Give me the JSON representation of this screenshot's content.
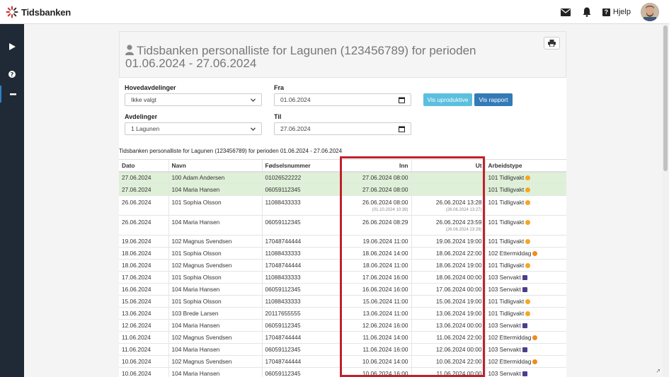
{
  "app": {
    "brand": "Tidsbanken",
    "help_label": "Hjelp"
  },
  "report": {
    "title": "Tidsbanken personalliste for Lagunen (123456789) for perioden 01.06.2024 - 27.06.2024",
    "caption": "Tidsbanken personalliste for Lagunen (123456789) for perioden 01.06.2024 - 27.06.2024"
  },
  "filters": {
    "hovedavdelinger_label": "Hovedavdelinger",
    "hovedavdelinger_value": "Ikke valgt",
    "avdelinger_label": "Avdelinger",
    "avdelinger_value": "1 Lagunen",
    "fra_label": "Fra",
    "fra_value": "01.06.2024",
    "til_label": "Til",
    "til_value": "27.06.2024",
    "btn_uproduktive": "Vis uproduktive",
    "btn_rapport": "Vis rapport"
  },
  "table": {
    "headers": {
      "dato": "Dato",
      "navn": "Navn",
      "fnr": "Fødselsnummer",
      "inn": "Inn",
      "ut": "Ut",
      "type": "Arbeidstype"
    },
    "rows": [
      {
        "dato": "27.06.2024",
        "navn": "100 Adam Andersen",
        "fnr": "01026522222",
        "inn": "27.06.2024 08:00",
        "inn_sub": "",
        "ut": "",
        "ut_sub": "",
        "type": "101 Tidligvakt",
        "icon": "sun-icon",
        "hl": true
      },
      {
        "dato": "27.06.2024",
        "navn": "104 Maria Hansen",
        "fnr": "06059112345",
        "inn": "27.06.2024 08:00",
        "inn_sub": "",
        "ut": "",
        "ut_sub": "",
        "type": "101 Tidligvakt",
        "icon": "sun-icon",
        "hl": true
      },
      {
        "dato": "26.06.2024",
        "navn": "101 Sophia Olsson",
        "fnr": "11088433333",
        "inn": "26.06.2024 08:00",
        "inn_sub": "(01.10.2024 10:39)",
        "ut": "26.06.2024 13:28",
        "ut_sub": "(26.06.2024 13:27)",
        "type": "101 Tidligvakt",
        "icon": "sun-icon",
        "hl": false
      },
      {
        "dato": "26.06.2024",
        "navn": "104 Maria Hansen",
        "fnr": "06059112345",
        "inn": "26.06.2024 08:29",
        "inn_sub": "",
        "ut": "26.06.2024 23:59",
        "ut_sub": "(26.06.2024 23:29)",
        "type": "101 Tidligvakt",
        "icon": "sun-icon",
        "hl": false
      },
      {
        "dato": "19.06.2024",
        "navn": "102 Magnus Svendsen",
        "fnr": "17048744444",
        "inn": "19.06.2024 11:00",
        "inn_sub": "",
        "ut": "19.06.2024 19:00",
        "ut_sub": "",
        "type": "101 Tidligvakt",
        "icon": "sun-icon",
        "hl": false
      },
      {
        "dato": "18.06.2024",
        "navn": "101 Sophia Olsson",
        "fnr": "11088433333",
        "inn": "18.06.2024 14:00",
        "inn_sub": "",
        "ut": "18.06.2024 22:00",
        "ut_sub": "",
        "type": "102 Ettermiddag",
        "icon": "sunset-icon",
        "hl": false
      },
      {
        "dato": "18.06.2024",
        "navn": "102 Magnus Svendsen",
        "fnr": "17048744444",
        "inn": "18.06.2024 11:00",
        "inn_sub": "",
        "ut": "18.06.2024 19:00",
        "ut_sub": "",
        "type": "101 Tidligvakt",
        "icon": "sun-icon",
        "hl": false
      },
      {
        "dato": "17.06.2024",
        "navn": "101 Sophia Olsson",
        "fnr": "11088433333",
        "inn": "17.06.2024 16:00",
        "inn_sub": "",
        "ut": "18.06.2024 00:00",
        "ut_sub": "",
        "type": "103 Senvakt",
        "icon": "moon-icon",
        "hl": false
      },
      {
        "dato": "16.06.2024",
        "navn": "104 Maria Hansen",
        "fnr": "06059112345",
        "inn": "16.06.2024 16:00",
        "inn_sub": "",
        "ut": "17.06.2024 00:00",
        "ut_sub": "",
        "type": "103 Senvakt",
        "icon": "moon-icon",
        "hl": false
      },
      {
        "dato": "15.06.2024",
        "navn": "101 Sophia Olsson",
        "fnr": "11088433333",
        "inn": "15.06.2024 11:00",
        "inn_sub": "",
        "ut": "15.06.2024 19:00",
        "ut_sub": "",
        "type": "101 Tidligvakt",
        "icon": "sun-icon",
        "hl": false
      },
      {
        "dato": "13.06.2024",
        "navn": "103 Brede Larsen",
        "fnr": "20117655555",
        "inn": "13.06.2024 11:00",
        "inn_sub": "",
        "ut": "13.06.2024 19:00",
        "ut_sub": "",
        "type": "101 Tidligvakt",
        "icon": "sun-icon",
        "hl": false
      },
      {
        "dato": "12.06.2024",
        "navn": "104 Maria Hansen",
        "fnr": "06059112345",
        "inn": "12.06.2024 16:00",
        "inn_sub": "",
        "ut": "13.06.2024 00:00",
        "ut_sub": "",
        "type": "103 Senvakt",
        "icon": "moon-icon",
        "hl": false
      },
      {
        "dato": "11.06.2024",
        "navn": "102 Magnus Svendsen",
        "fnr": "17048744444",
        "inn": "11.06.2024 14:00",
        "inn_sub": "",
        "ut": "11.06.2024 22:00",
        "ut_sub": "",
        "type": "102 Ettermiddag",
        "icon": "sunset-icon",
        "hl": false
      },
      {
        "dato": "11.06.2024",
        "navn": "104 Maria Hansen",
        "fnr": "06059112345",
        "inn": "11.06.2024 16:00",
        "inn_sub": "",
        "ut": "12.06.2024 00:00",
        "ut_sub": "",
        "type": "103 Senvakt",
        "icon": "moon-icon",
        "hl": false
      },
      {
        "dato": "10.06.2024",
        "navn": "102 Magnus Svendsen",
        "fnr": "17048744444",
        "inn": "10.06.2024 14:00",
        "inn_sub": "",
        "ut": "10.06.2024 22:00",
        "ut_sub": "",
        "type": "102 Ettermiddag",
        "icon": "sunset-icon",
        "hl": false
      },
      {
        "dato": "10.06.2024",
        "navn": "104 Maria Hansen",
        "fnr": "06059112345",
        "inn": "10.06.2024 16:00",
        "inn_sub": "",
        "ut": "11.06.2024 00:00",
        "ut_sub": "",
        "type": "103 Senvakt",
        "icon": "moon-icon",
        "hl": false
      }
    ]
  },
  "colors": {
    "sidebar": "#1f2a36",
    "highlight_row": "#dff0d8",
    "btn_info": "#5bc0de",
    "btn_primary": "#337ab7",
    "annotation": "#c0212c"
  }
}
